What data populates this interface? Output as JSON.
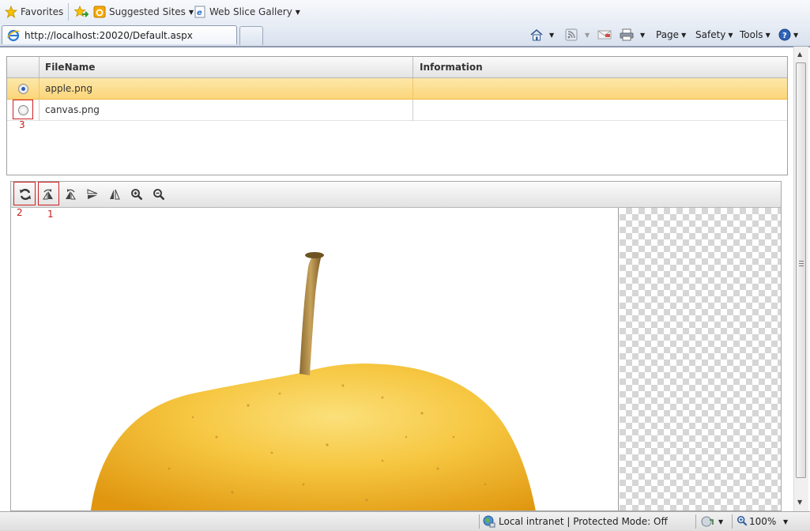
{
  "favorites_bar": {
    "favorites": "Favorites",
    "suggested_sites": "Suggested Sites",
    "web_slice_gallery": "Web Slice Gallery"
  },
  "tab": {
    "url": "http://localhost:20020/Default.aspx"
  },
  "command_bar": {
    "page": "Page",
    "safety": "Safety",
    "tools": "Tools"
  },
  "grid": {
    "columns": [
      "FileName",
      "Information"
    ],
    "rows": [
      {
        "file": "apple.png",
        "info": "",
        "selected": true
      },
      {
        "file": "canvas.png",
        "info": "",
        "selected": false
      }
    ]
  },
  "annotations": {
    "one": "1",
    "two": "2",
    "three": "3"
  },
  "editor": {
    "tools": [
      "refresh-icon",
      "rotate-icon",
      "rotate-left-icon",
      "flip-vertical-icon",
      "flip-horizontal-icon",
      "zoom-in-icon",
      "zoom-out-icon"
    ]
  },
  "status": {
    "zone": "Local intranet | Protected Mode: Off",
    "zoom": "100%"
  },
  "colors": {
    "accent": "#2b5fb4",
    "selection": "#fbd57a",
    "annotation": "#d02020"
  }
}
